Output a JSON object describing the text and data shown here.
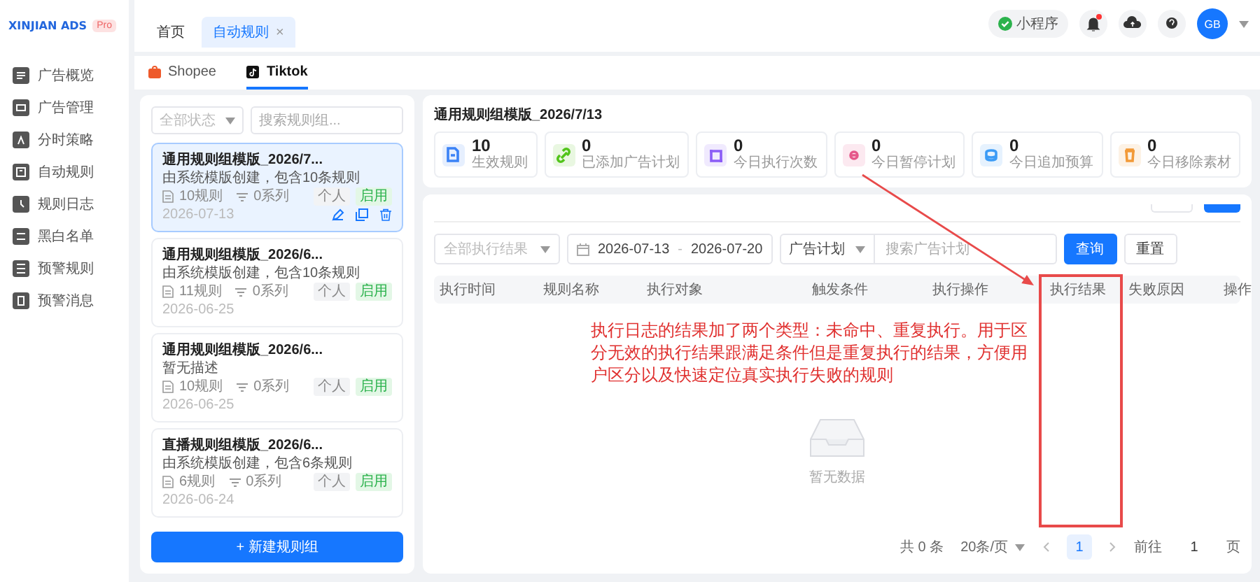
{
  "sidebar": {
    "logo": "XINJIAN ADS",
    "badge": "Pro",
    "items": [
      {
        "label": "广告概览",
        "selected": false
      },
      {
        "label": "广告管理",
        "selected": false
      },
      {
        "label": "分时策略",
        "selected": false
      },
      {
        "label": "自动规则",
        "selected": false
      },
      {
        "label": "规则日志",
        "selected": false
      },
      {
        "label": "黑白名单",
        "selected": false
      },
      {
        "label": "预警规则",
        "selected": false
      },
      {
        "label": "预警消息",
        "selected": false
      }
    ]
  },
  "header": {
    "tabs": [
      {
        "label": "首页",
        "selected": false,
        "closable": false
      },
      {
        "label": "自动规则",
        "selected": true,
        "closable": true,
        "close": "×"
      }
    ],
    "mini_program": "小程序",
    "notification_dot": true,
    "avatar": "GB"
  },
  "platform_tabs": [
    {
      "label": "Shopee",
      "selected": false
    },
    {
      "label": "Tiktok",
      "selected": true
    }
  ],
  "rule_groups": {
    "status_filter": {
      "placeholder": "全部状态"
    },
    "search": {
      "placeholder": "搜索规则组..."
    },
    "items": [
      {
        "title": "通用规则组模版_2026/7...",
        "scope": "个人",
        "status": "启用",
        "description": "由系统模版创建，包含10条规则",
        "rules": "10规则",
        "series": "0系列",
        "date": "2026-07-13",
        "selected": true
      },
      {
        "title": "通用规则组模版_2026/6...",
        "scope": "个人",
        "status": "启用",
        "description": "由系统模版创建，包含10条规则",
        "rules": "11规则",
        "series": "0系列",
        "date": "2026-06-25",
        "selected": false
      },
      {
        "title": "通用规则组模版_2026/6...",
        "scope": "个人",
        "status": "启用",
        "description": "暂无描述",
        "rules": "10规则",
        "series": "0系列",
        "date": "2026-06-25",
        "selected": false
      },
      {
        "title": "直播规则组模版_2026/6...",
        "scope": "个人",
        "status": "启用",
        "description": "由系统模版创建，包含6条规则",
        "rules": "6规则",
        "series": "0系列",
        "date": "2026-06-24",
        "selected": false
      }
    ],
    "new_button": "+ 新建规则组"
  },
  "detail": {
    "title": "通用规则组模版_2026/7/13",
    "stats": [
      {
        "value": "10",
        "label": "生效规则",
        "color": "#3b82f6"
      },
      {
        "value": "0",
        "label": "已添加广告计划",
        "color": "#52c41a"
      },
      {
        "value": "0",
        "label": "今日执行次数",
        "color": "#8b5cf6"
      },
      {
        "value": "0",
        "label": "今日暂停计划",
        "color": "#e5588a"
      },
      {
        "value": "0",
        "label": "今日追加预算",
        "color": "#3b9bf6"
      },
      {
        "value": "0",
        "label": "今日移除素材",
        "color": "#f29a38"
      }
    ],
    "filters": {
      "result_select": {
        "placeholder": "全部执行结果"
      },
      "date_range": {
        "start": "2026-07-13",
        "separator": "-",
        "end": "2026-07-20"
      },
      "type_select": {
        "value": "广告计划"
      },
      "search": {
        "placeholder": "搜索广告计划"
      },
      "buttons": [
        {
          "label": "查询",
          "kind": "primary"
        },
        {
          "label": "重置",
          "kind": "default"
        }
      ]
    },
    "table": {
      "columns": [
        {
          "label": "执行时间",
          "highlighted": false
        },
        {
          "label": "规则名称",
          "highlighted": false
        },
        {
          "label": "执行对象",
          "highlighted": false
        },
        {
          "label": "触发条件",
          "highlighted": false
        },
        {
          "label": "执行操作",
          "highlighted": false
        },
        {
          "label": "执行结果",
          "highlighted": true
        },
        {
          "label": "失败原因",
          "highlighted": false
        },
        {
          "label": "操作",
          "highlighted": false
        }
      ],
      "empty_text": "暂无数据"
    },
    "pagination": {
      "total": "共 0 条",
      "page_size": "20条/页",
      "pages": [
        {
          "label": "1",
          "selected": true
        }
      ],
      "goto_label": "前往",
      "goto_value": "1",
      "goto_suffix": "页"
    }
  },
  "annotation": {
    "text": "执行日志的结果加了两个类型：未命中、重复执行。用于区分无效的执行结果跟满足条件但是重复执行的结果，方便用户区分以及快速定位真实执行失败的规则"
  }
}
